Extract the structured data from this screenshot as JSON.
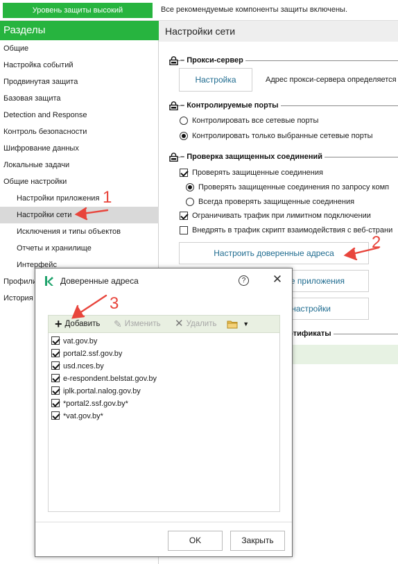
{
  "status": {
    "badge": "Уровень защиты высокий",
    "message": "Все рекомендуемые компоненты защиты включены.",
    "badge_color": "#27b43f"
  },
  "sidebar": {
    "header": "Разделы",
    "items": [
      {
        "label": "Общие",
        "level": 1
      },
      {
        "label": "Настройка событий",
        "level": 1
      },
      {
        "label": "Продвинутая защита",
        "level": 1
      },
      {
        "label": "Базовая защита",
        "level": 1
      },
      {
        "label": "Detection and Response",
        "level": 1
      },
      {
        "label": "Контроль безопасности",
        "level": 1
      },
      {
        "label": "Шифрование данных",
        "level": 1
      },
      {
        "label": "Локальные задачи",
        "level": 1
      },
      {
        "label": "Общие настройки",
        "level": 1
      },
      {
        "label": "Настройки приложения",
        "level": 2
      },
      {
        "label": "Настройки сети",
        "level": 2,
        "active": true
      },
      {
        "label": "Исключения и типы объектов",
        "level": 2
      },
      {
        "label": "Отчеты и хранилище",
        "level": 2
      },
      {
        "label": "Интерфейс",
        "level": 2
      },
      {
        "label": "Профили",
        "level": 1
      },
      {
        "label": "История",
        "level": 1
      }
    ]
  },
  "content": {
    "title": "Настройки сети",
    "proxy": {
      "title": "Прокси-сервер",
      "button": "Настройка",
      "description": "Адрес прокси-сервера определяется"
    },
    "ports": {
      "title": "Контролируемые порты",
      "option_all": "Контролировать все сетевые порты",
      "option_selected": "Контролировать только выбранные сетевые порты",
      "selected": "option_selected"
    },
    "secure": {
      "title": "Проверка защищенных соединений",
      "check_secure": "Проверять защищенные соединения",
      "check_secure_on": true,
      "radio_on_request": "Проверять защищенные соединения по запросу комп",
      "radio_on_request_on": true,
      "radio_always": "Всегда проверять защищенные соединения",
      "radio_always_on": false,
      "check_limit": "Ограничивать трафик при лимитном подключении",
      "check_limit_on": true,
      "check_inject": "Внедрять в трафик скрипт взаимодействия с веб-страни",
      "check_inject_on": false,
      "trusted_button": "Настроить доверенные адреса",
      "apps_button_partial": "е приложения",
      "settings_button_partial": "настройки",
      "certs_partial": "ертификаты"
    }
  },
  "dialog": {
    "title": "Доверенные адреса",
    "help": "?",
    "close": "✕",
    "toolbar": {
      "add": "Добавить",
      "edit": "Изменить",
      "delete": "Удалить"
    },
    "items": [
      {
        "label": "vat.gov.by",
        "checked": true
      },
      {
        "label": "portal2.ssf.gov.by",
        "checked": true
      },
      {
        "label": "usd.nces.by",
        "checked": true
      },
      {
        "label": "e-respondent.belstat.gov.by",
        "checked": true
      },
      {
        "label": "iplk.portal.nalog.gov.by",
        "checked": true
      },
      {
        "label": "*portal2.ssf.gov.by*",
        "checked": true
      },
      {
        "label": "*vat.gov.by*",
        "checked": true
      }
    ],
    "ok": "OK",
    "close_button": "Закрыть"
  },
  "annotations": {
    "step1": "1",
    "step2": "2",
    "step3": "3",
    "color": "#e8453c"
  }
}
